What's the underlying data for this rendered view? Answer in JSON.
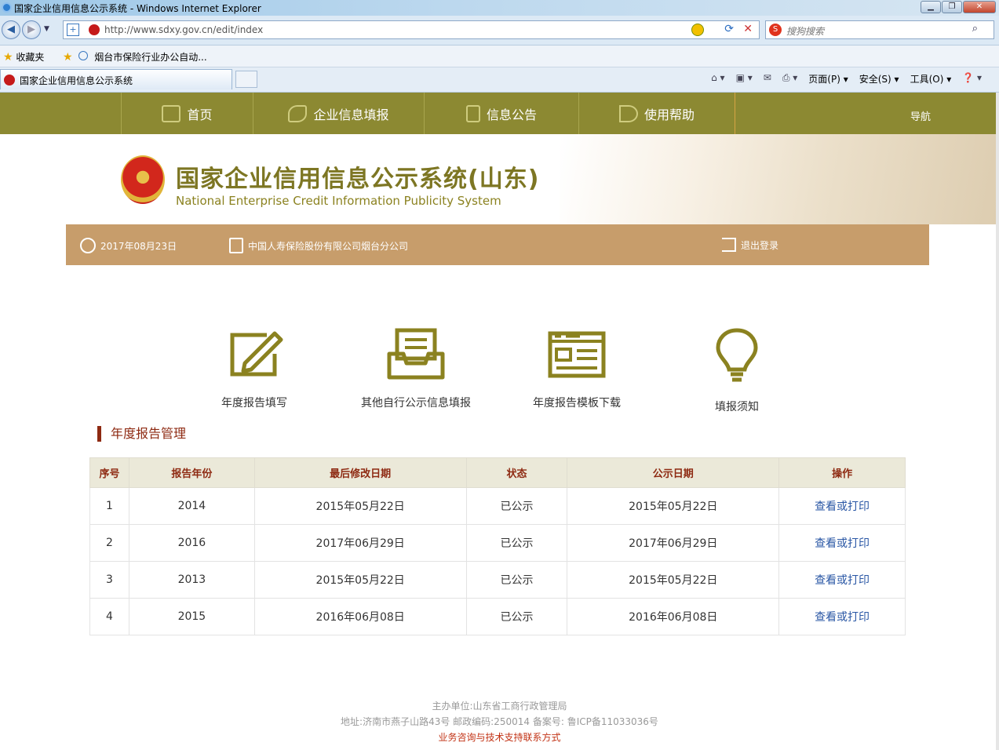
{
  "browser": {
    "window_title": "国家企业信用信息公示系统 - Windows Internet Explorer",
    "url": "http://www.sdxy.gov.cn/edit/index",
    "search_placeholder": "搜狗搜索",
    "favorites_label": "收藏夹",
    "favorite_link": "烟台市保险行业办公自动...",
    "tab_title": "国家企业信用信息公示系统",
    "commands": {
      "page": "页面(P)",
      "safety": "安全(S)",
      "tools": "工具(O)"
    }
  },
  "nav": {
    "items": [
      {
        "label": "首页",
        "icon": "monitor-icon"
      },
      {
        "label": "企业信息填报",
        "icon": "pen-icon"
      },
      {
        "label": "信息公告",
        "icon": "document-icon"
      },
      {
        "label": "使用帮助",
        "icon": "speaker-icon"
      }
    ],
    "guide": "导航"
  },
  "banner": {
    "title_cn": "国家企业信用信息公示系统(山东)",
    "title_en": "National Enterprise Credit Information Publicity System"
  },
  "infobar": {
    "date": "2017年08月23日",
    "company": "中国人寿保险股份有限公司烟台分公司",
    "logout": "退出登录"
  },
  "quick_actions": [
    {
      "label": "年度报告填写",
      "icon": "edit-icon"
    },
    {
      "label": "其他自行公示信息填报",
      "icon": "inbox-icon"
    },
    {
      "label": "年度报告模板下载",
      "icon": "template-icon"
    },
    {
      "label": "填报须知",
      "icon": "lightbulb-icon"
    }
  ],
  "section_title": "年度报告管理",
  "table": {
    "headers": [
      "序号",
      "报告年份",
      "最后修改日期",
      "状态",
      "公示日期",
      "操作"
    ],
    "rows": [
      {
        "no": "1",
        "year": "2014",
        "modified": "2015年05月22日",
        "status": "已公示",
        "published": "2015年05月22日",
        "action": "查看或打印"
      },
      {
        "no": "2",
        "year": "2016",
        "modified": "2017年06月29日",
        "status": "已公示",
        "published": "2017年06月29日",
        "action": "查看或打印"
      },
      {
        "no": "3",
        "year": "2013",
        "modified": "2015年05月22日",
        "status": "已公示",
        "published": "2015年05月22日",
        "action": "查看或打印"
      },
      {
        "no": "4",
        "year": "2015",
        "modified": "2016年06月08日",
        "status": "已公示",
        "published": "2016年06月08日",
        "action": "查看或打印"
      }
    ]
  },
  "footer": {
    "host": "主办单位:山东省工商行政管理局",
    "address": "地址:济南市燕子山路43号    邮政编码:250014    备案号: 鲁ICP备11033036号",
    "contact": "业务咨询与技术支持联系方式"
  },
  "colors": {
    "nav_bg": "#8c8932",
    "info_bg": "#c79d6b",
    "accent": "#8e2a12",
    "icon": "#8b8220",
    "link": "#2a57a5"
  }
}
